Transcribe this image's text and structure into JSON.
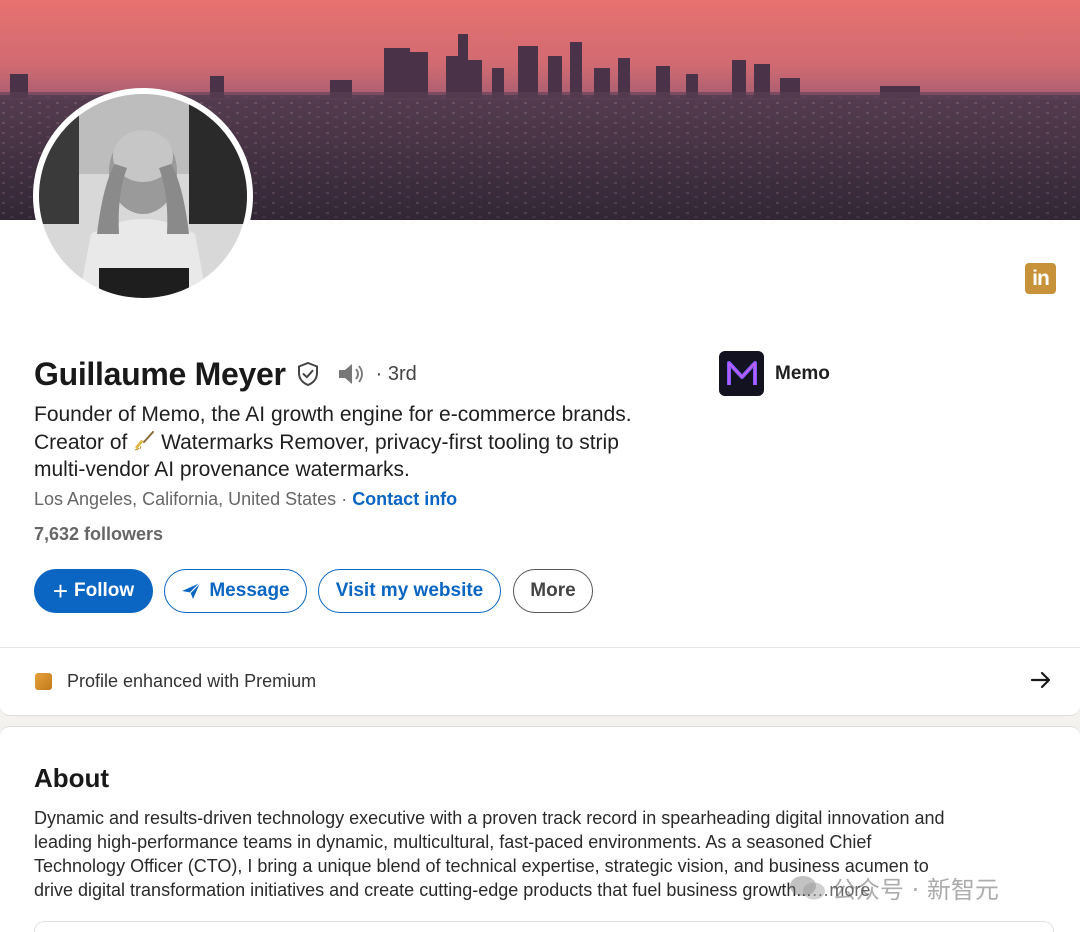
{
  "profile": {
    "name": "Guillaume Meyer",
    "degree": "· 3rd",
    "headline_lines": [
      "Founder of Memo, the AI growth engine for e-commerce brands.",
      "Creator of",
      "Watermarks Remover, privacy-first tooling to strip",
      "multi-vendor AI provenance watermarks."
    ],
    "location": "Los Angeles, California, United States",
    "separator": " · ",
    "contact_info": "Contact info",
    "followers": "7,632 followers"
  },
  "company": {
    "name": "Memo",
    "logo_letter": "M",
    "logo_subtext": "memo"
  },
  "brand_badge": "in",
  "actions": {
    "follow_plus": "+",
    "follow_label": "Follow",
    "message_label": "Message",
    "website_label": "Visit my website",
    "more_label": "More"
  },
  "premium": {
    "label": "Profile enhanced with Premium",
    "arrow": "→"
  },
  "about": {
    "title": "About",
    "lines": [
      "Dynamic and results-driven technology executive with a proven track record in spearheading digital innovation and",
      "leading high-performance teams in dynamic, multicultural, fast-paced environments. As a seasoned Chief",
      "Technology Officer (CTO), I bring a unique blend of technical expertise, strategic vision, and business acumen to",
      "drive digital transformation initiatives and create cutting-edge products that fuel business growth..."
    ],
    "more_label": "…more"
  },
  "watermark": {
    "text": "公众号 · 新智元"
  },
  "colors": {
    "primary": "#0a66c2",
    "premium_gold": "#c8923a",
    "sky_top": "#e8726f",
    "sky_bottom": "#7a4c6c"
  },
  "icons": {
    "verified": "shield-check-icon",
    "pronunciation": "speaker-icon",
    "message": "send-icon",
    "premium": "premium-badge-icon",
    "arrow": "arrow-right-icon"
  }
}
